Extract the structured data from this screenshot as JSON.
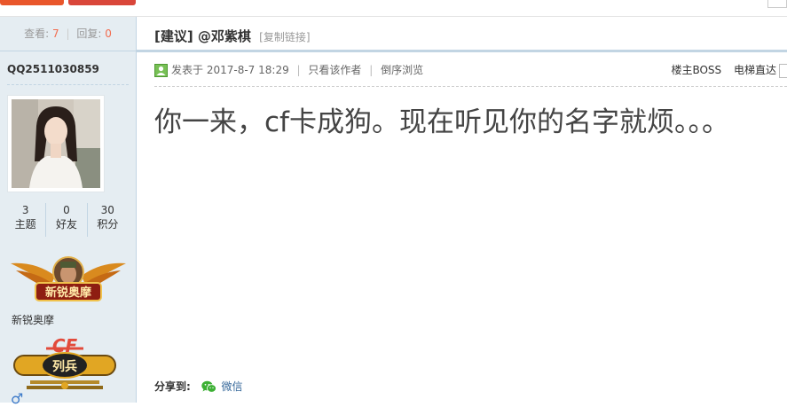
{
  "colors": {
    "accent": "#f26c4f",
    "sidebar_bg": "#e5edf2",
    "border": "#c2d5e3",
    "link": "#336699",
    "wechat": "#3cb034"
  },
  "thread": {
    "views_label": "查看:",
    "views": "7",
    "replies_label": "回复:",
    "replies": "0",
    "title": "[建议] @邓紫棋",
    "copy_link": "[复制链接]"
  },
  "author": {
    "name": "QQ2511030859",
    "stats": [
      {
        "value": "3",
        "label": "主题"
      },
      {
        "value": "0",
        "label": "好友"
      },
      {
        "value": "30",
        "label": "积分"
      }
    ],
    "badge1_text": "新锐奥摩",
    "badge1_label": "新锐奥摩",
    "badge2_text": "列兵",
    "badge2_logo": "CF",
    "gender_icon": "♂"
  },
  "post": {
    "posted_prefix": "发表于",
    "posted_time": "2017-8-7 18:29",
    "only_author": "只看该作者",
    "reverse_view": "倒序浏览",
    "floor_label": "楼主BOSS",
    "elevator": "电梯直达",
    "content": "你一来，cf卡成狗。现在听见你的名字就烦。。。"
  },
  "share": {
    "label": "分享到:",
    "wechat": "微信"
  }
}
